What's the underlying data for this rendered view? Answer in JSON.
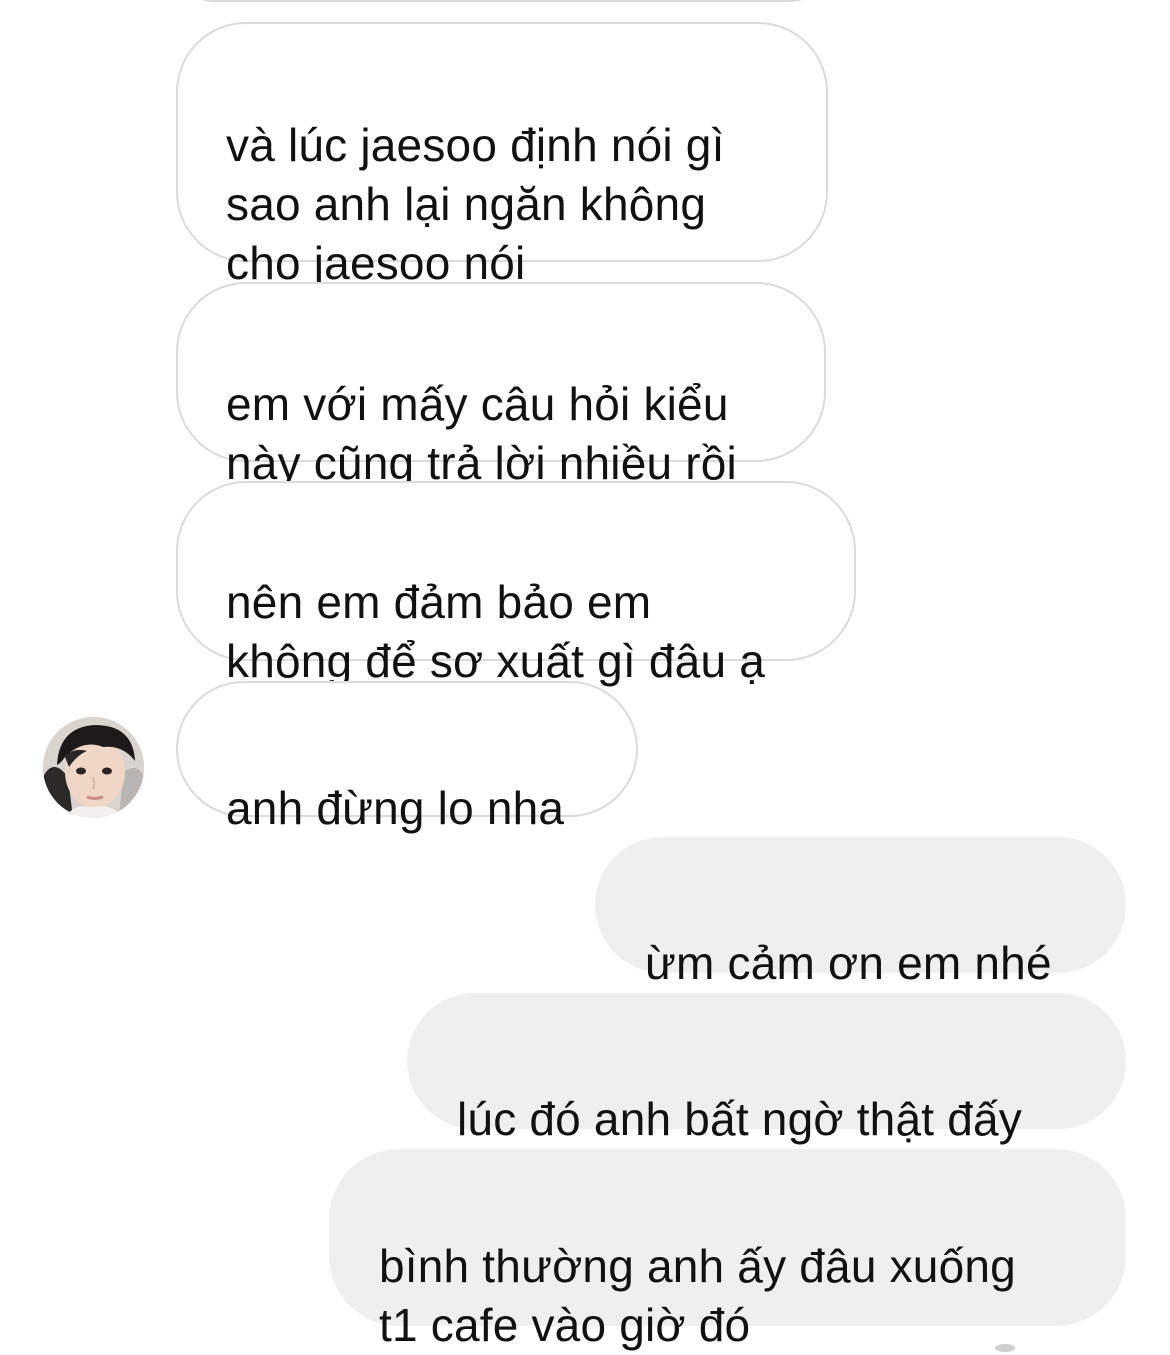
{
  "conversation": {
    "incoming_messages": [
      {
        "text": "và lúc jaesoo định nói gì\nsao anh lại ngăn không\ncho jaesoo nói"
      },
      {
        "text": "em với mấy câu hỏi kiểu\nnày cũng trả lời nhiều rồi"
      },
      {
        "text": "nên em đảm bảo em\nkhông để sơ xuất gì đâu ạ"
      },
      {
        "text": "anh đừng lo nha"
      }
    ],
    "outgoing_messages": [
      {
        "text": "ừm cảm ơn em nhé"
      },
      {
        "text": "lúc đó anh bất ngờ thật đấy"
      },
      {
        "text": "bình thường anh ấy đâu xuống\nt1 cafe vào giờ đó"
      }
    ],
    "sender_avatar": {
      "icon": "profile-photo"
    },
    "colors": {
      "incoming_bubble_border": "#dbdbdb",
      "incoming_bubble_background": "#ffffff",
      "outgoing_bubble_background": "#efefef",
      "text": "#111111"
    }
  }
}
